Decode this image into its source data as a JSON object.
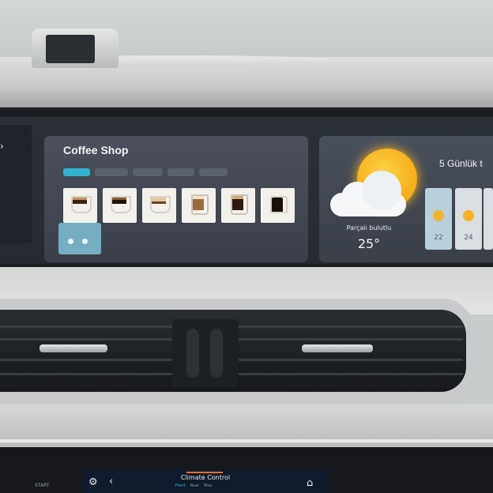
{
  "coffee": {
    "title": "Coffee Shop",
    "tabs": [
      "",
      "",
      "",
      "",
      ""
    ],
    "items": [
      {
        "icon": "espresso-cup-icon"
      },
      {
        "icon": "americano-cup-icon"
      },
      {
        "icon": "cappuccino-cup-icon"
      },
      {
        "icon": "latte-cup-icon"
      },
      {
        "icon": "macchiato-glass-icon"
      },
      {
        "icon": "cold-brew-glass-icon"
      }
    ]
  },
  "weather": {
    "description": "Parçalı bulutlu",
    "temperature": "25°",
    "forecast_title": "5 Günlük t",
    "forecast": [
      {
        "temp": "22",
        "icon": "partly-sunny-icon"
      },
      {
        "temp": "24",
        "icon": "sun-icon"
      }
    ]
  },
  "climate": {
    "title": "Climate Control",
    "start_label": "START",
    "accent_color": "#e76b2a",
    "tabs": [
      "Front",
      "Rear",
      "Misc"
    ]
  }
}
